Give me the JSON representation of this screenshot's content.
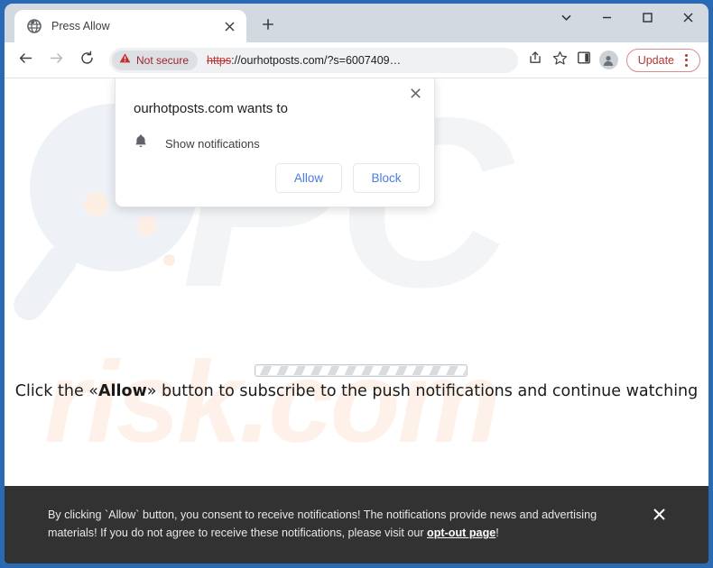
{
  "browser": {
    "tab": {
      "title": "Press Allow",
      "favicon_icon": "globe-icon",
      "close_icon": "close-icon"
    },
    "new_tab_icon": "plus-icon",
    "window_controls": {
      "tab_search_icon": "chevron-down-icon",
      "minimize_icon": "minimize-icon",
      "maximize_icon": "maximize-icon",
      "close_icon": "close-icon"
    },
    "toolbar": {
      "back_icon": "arrow-left-icon",
      "forward_icon": "arrow-right-icon",
      "reload_icon": "reload-icon",
      "security_warning_icon": "warning-triangle-icon",
      "security_label": "Not secure",
      "url_scheme": "https",
      "url_rest": "://ourhotposts.com/?s=6007409…",
      "share_icon": "share-icon",
      "bookmark_icon": "star-icon",
      "side_panel_icon": "side-panel-icon",
      "profile_icon": "profile-avatar-icon",
      "update_label": "Update",
      "menu_icon": "kebab-menu-icon"
    }
  },
  "permission_dialog": {
    "title": "ourhotposts.com wants to",
    "permission_icon": "bell-icon",
    "permission_label": "Show notifications",
    "allow_label": "Allow",
    "block_label": "Block",
    "close_icon": "close-icon"
  },
  "page": {
    "cta_prefix": "Click the «",
    "cta_bold": "Allow",
    "cta_suffix": "» button to subscribe to the push notifications and continue watching",
    "progress_label": "loading-progress-bar",
    "watermark_pc": "PC",
    "watermark_risk": "risk.com"
  },
  "consent_banner": {
    "text_part1": "By clicking `Allow` button, you consent to receive notifications! The notifications provide news and advertising materials! If you do not agree to receive these notifications, please visit our ",
    "link_label": "opt-out page",
    "text_part2": "!",
    "close_icon": "close-icon"
  },
  "colors": {
    "window_frame": "#2a6ab5",
    "tabstrip": "#d3d9e0",
    "not_secure_red": "#a0252b",
    "update_red": "#b03a32",
    "dialog_button_blue": "#4a7ce0",
    "banner_bg": "#323232"
  }
}
